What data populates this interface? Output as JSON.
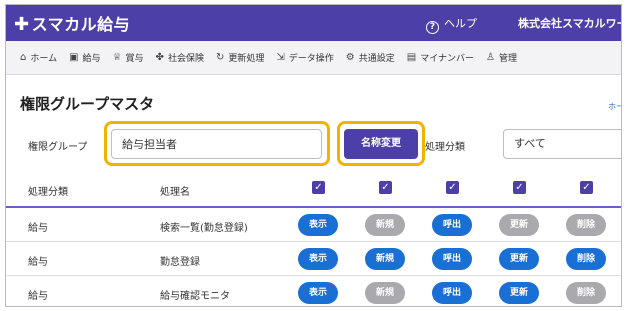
{
  "app": {
    "logo_plus": "✚",
    "logo": "スマカル給与",
    "help": "ヘルプ",
    "company": "株式会社スマカルワー"
  },
  "nav": [
    {
      "icon": "⌂",
      "label": "ホーム"
    },
    {
      "icon": "▣",
      "label": "給与"
    },
    {
      "icon": "♕",
      "label": "賞与"
    },
    {
      "icon": "✤",
      "label": "社会保険"
    },
    {
      "icon": "↻",
      "label": "更新処理"
    },
    {
      "icon": "⇲",
      "label": "データ操作"
    },
    {
      "icon": "⚙",
      "label": "共通設定"
    },
    {
      "icon": "▤",
      "label": "マイナンバー"
    },
    {
      "icon": "♙",
      "label": "管理"
    }
  ],
  "page": {
    "title": "権限グループマスタ",
    "home_link": "ホー"
  },
  "form": {
    "group_label": "権限グループ",
    "group_value": "給与担当者",
    "rename_button": "名称変更",
    "class_label": "処理分類",
    "class_value": "すべて"
  },
  "table": {
    "col_class": "処理分類",
    "col_name": "処理名",
    "check_mark": "✓",
    "rows": [
      {
        "class": "給与",
        "name": "検索一覧(勤怠登録)",
        "buttons": [
          {
            "label": "表示",
            "on": true
          },
          {
            "label": "新規",
            "on": false
          },
          {
            "label": "呼出",
            "on": true
          },
          {
            "label": "更新",
            "on": false
          },
          {
            "label": "削除",
            "on": false
          }
        ]
      },
      {
        "class": "給与",
        "name": "勤怠登録",
        "buttons": [
          {
            "label": "表示",
            "on": true
          },
          {
            "label": "新規",
            "on": true
          },
          {
            "label": "呼出",
            "on": true
          },
          {
            "label": "更新",
            "on": true
          },
          {
            "label": "削除",
            "on": true
          }
        ]
      },
      {
        "class": "給与",
        "name": "給与確認モニタ",
        "buttons": [
          {
            "label": "表示",
            "on": true
          },
          {
            "label": "新規",
            "on": false
          },
          {
            "label": "呼出",
            "on": true
          },
          {
            "label": "更新",
            "on": true
          },
          {
            "label": "削除",
            "on": false
          }
        ]
      }
    ]
  },
  "colors": {
    "brand": "#4c3fa8",
    "on": "#1a6fd4",
    "off": "#a9a9ae",
    "highlight": "#f0b400"
  }
}
